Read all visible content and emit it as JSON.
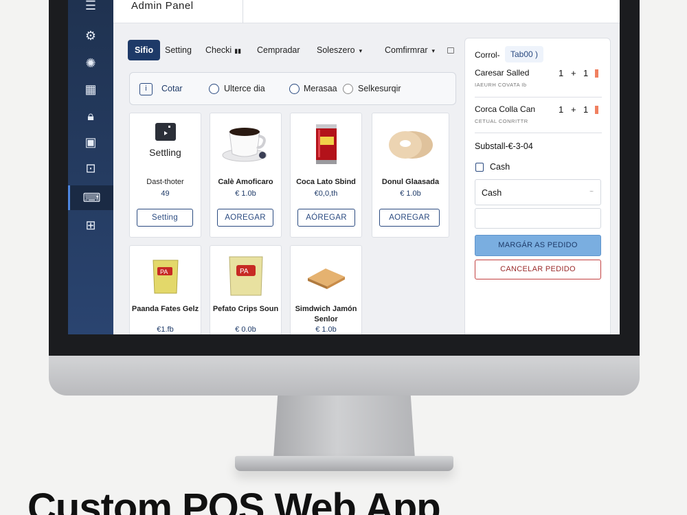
{
  "app": {
    "title": "Admin Panel"
  },
  "sidebar": {
    "items": [
      {
        "name": "menu-icon",
        "glyph": "☰"
      },
      {
        "name": "settings-icon",
        "glyph": "⚙"
      },
      {
        "name": "gear-icon",
        "glyph": "✺"
      },
      {
        "name": "calendar-icon",
        "glyph": "▦"
      },
      {
        "name": "lock-icon",
        "glyph": "🔒︎"
      },
      {
        "name": "box-icon",
        "glyph": "▣"
      },
      {
        "name": "register-icon",
        "glyph": "⊡"
      },
      {
        "name": "keyboard-icon",
        "glyph": "⌨",
        "active": true
      },
      {
        "name": "more-icon",
        "glyph": "⊞"
      }
    ]
  },
  "tabs": [
    {
      "label": "Sifio",
      "active": true
    },
    {
      "label": "Setting"
    },
    {
      "label": "Checki",
      "extra": "▮▮"
    },
    {
      "label": "Cempradar"
    },
    {
      "label": "Soleszero",
      "caret": "▾"
    },
    {
      "label": "Comfirmrar",
      "caret": "▾"
    }
  ],
  "filters": {
    "info_label": "Cotar",
    "options": [
      "Ulterce dia",
      "Merasaa",
      "Selkesurqir"
    ]
  },
  "products": [
    {
      "name": "Dast-thoter",
      "price": "49",
      "action": "Setting",
      "header": "Settling",
      "image": "settings-tile"
    },
    {
      "name": "Calè Amoficaro",
      "price": "€ 1.0b",
      "action": "AOREGAR",
      "image": "coffee-cup"
    },
    {
      "name": "Coca Lato Sbind",
      "price": "€0,0,th",
      "action": "AÓREGAR",
      "image": "soda-can"
    },
    {
      "name": "Donul Glaasada",
      "price": "€ 1.0b",
      "action": "AOREGAR",
      "image": "donut"
    },
    {
      "name": "Paanda Fates Gelz",
      "price": "€1.fb",
      "image": "chips-bag"
    },
    {
      "name": "Pefato Crips Soun",
      "price": "€ 0.0b",
      "image": "chips-bag"
    },
    {
      "name": "Simdwich Jamón Senlor",
      "price": "€ 1.0b",
      "image": "sandwich"
    }
  ],
  "order": {
    "header": "Corrol-",
    "tag": "Tab00 )",
    "lines": [
      {
        "name": "Caresar Salled",
        "sub": "IAEURH COVATA Ib",
        "qty_a": "1",
        "op": "+",
        "qty_b": "1"
      },
      {
        "name": "Corca Colla Can",
        "sub": "CETUAL CONRITTR",
        "qty_a": "1",
        "op": "+",
        "qty_b": "1"
      }
    ],
    "subtotal": "Substall-€-3-04",
    "payment_checkbox_label": "Cash",
    "payment_select_value": "Cash",
    "primary_button": "MARGÁR AS PEDIDO",
    "cancel_button": "CANCELAR PEDIDO"
  },
  "headline": "Custom POS Web App",
  "colors": {
    "sidebar": "#1f3250",
    "accent": "#1e3a68",
    "primary_button": "#7aaee0",
    "cancel": "#c24040"
  }
}
